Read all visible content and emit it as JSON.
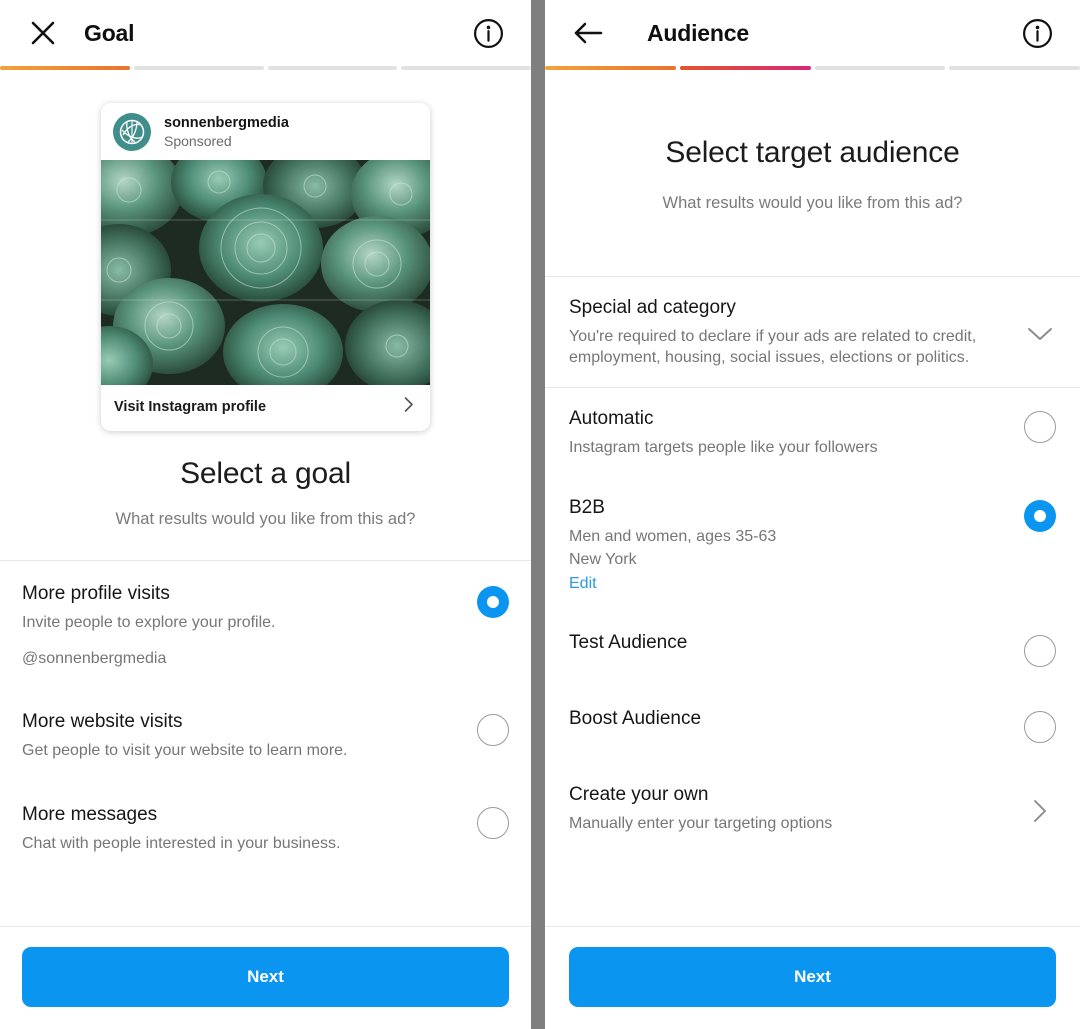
{
  "left_panel": {
    "header": {
      "close_icon": "close-x-icon",
      "title": "Goal",
      "info_icon": "info-circle-icon"
    },
    "progress": {
      "total_steps": 4,
      "completed_steps": 1,
      "segments": [
        "orange",
        "empty",
        "empty",
        "empty"
      ]
    },
    "ad_preview": {
      "username": "sonnenbergmedia",
      "sponsored_label": "Sponsored",
      "avatar_icon": "leaf-globe-logo-icon",
      "image_alt": "succulent-plants-photo",
      "cta_label": "Visit Instagram profile",
      "cta_icon": "chevron-right-icon"
    },
    "section": {
      "title": "Select a goal",
      "subtitle": "What results would you like from this ad?"
    },
    "options": [
      {
        "title": "More profile visits",
        "desc": "Invite people to explore your profile.",
        "extra": "@sonnenbergmedia",
        "selected": true
      },
      {
        "title": "More website visits",
        "desc": "Get people to visit your website to learn more.",
        "selected": false
      },
      {
        "title": "More messages",
        "desc": "Chat with people interested in your business.",
        "selected": false
      }
    ],
    "footer": {
      "next_label": "Next"
    }
  },
  "right_panel": {
    "header": {
      "back_icon": "arrow-left-icon",
      "title": "Audience",
      "info_icon": "info-circle-icon"
    },
    "progress": {
      "total_steps": 4,
      "completed_steps": 2,
      "segments": [
        "orange",
        "pink",
        "empty",
        "empty"
      ]
    },
    "section": {
      "title": "Select target audience",
      "subtitle": "What results would you like from this ad?"
    },
    "special_ad_category": {
      "title": "Special ad category",
      "desc": "You're required to declare if your ads are related to credit, employment, housing, social issues, elections or politics.",
      "expander_icon": "chevron-down-icon"
    },
    "options": [
      {
        "title": "Automatic",
        "desc": "Instagram targets people like your followers",
        "selected": false
      },
      {
        "title": "B2B",
        "desc": "Men and women, ages 35-63",
        "desc2": "New York",
        "link": "Edit",
        "selected": true
      },
      {
        "title": "Test Audience",
        "selected": false
      },
      {
        "title": "Boost Audience",
        "selected": false
      }
    ],
    "create_own": {
      "title": "Create your own",
      "desc": "Manually enter your targeting options",
      "icon": "chevron-right-icon"
    },
    "footer": {
      "next_label": "Next"
    }
  },
  "colors": {
    "accent_blue": "#0a95f0",
    "link_blue": "#2b9ae0",
    "progress_orange": "#e8732e",
    "progress_pink": "#d62976",
    "avatar_teal": "#3f8e8b"
  }
}
